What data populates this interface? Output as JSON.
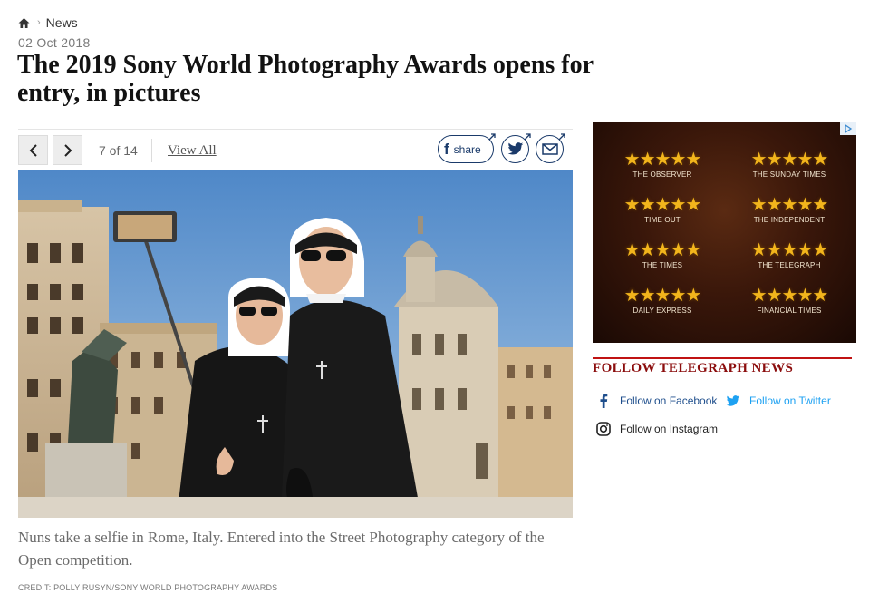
{
  "breadcrumb": {
    "home_icon": "home-icon",
    "section": "News"
  },
  "article": {
    "date": "02 Oct 2018",
    "headline": "The 2019 Sony World Photography Awards opens for entry, in pictures"
  },
  "gallery": {
    "counter": "7 of 14",
    "view_all": "View All",
    "share_label": "share",
    "caption": "Nuns take a selfie in Rome, Italy. Entered into the Street Photography category of the Open competition.",
    "credit": "CREDIT: POLLY RUSYN/SONY WORLD PHOTOGRAPHY AWARDS"
  },
  "ad": {
    "stars": "★★★★★",
    "reviews": [
      "THE OBSERVER",
      "THE SUNDAY TIMES",
      "TIME OUT",
      "THE INDEPENDENT",
      "THE TIMES",
      "THE TELEGRAPH",
      "DAILY EXPRESS",
      "FINANCIAL TIMES"
    ],
    "star_color": "#f2b51c"
  },
  "follow": {
    "heading": "FOLLOW TELEGRAPH NEWS",
    "facebook": "Follow on Facebook",
    "twitter": "Follow on Twitter",
    "instagram": "Follow on Instagram"
  },
  "colors": {
    "brand_red": "#8b0d0d",
    "share_blue": "#1a3a6a",
    "twitter": "#1da1f2"
  }
}
